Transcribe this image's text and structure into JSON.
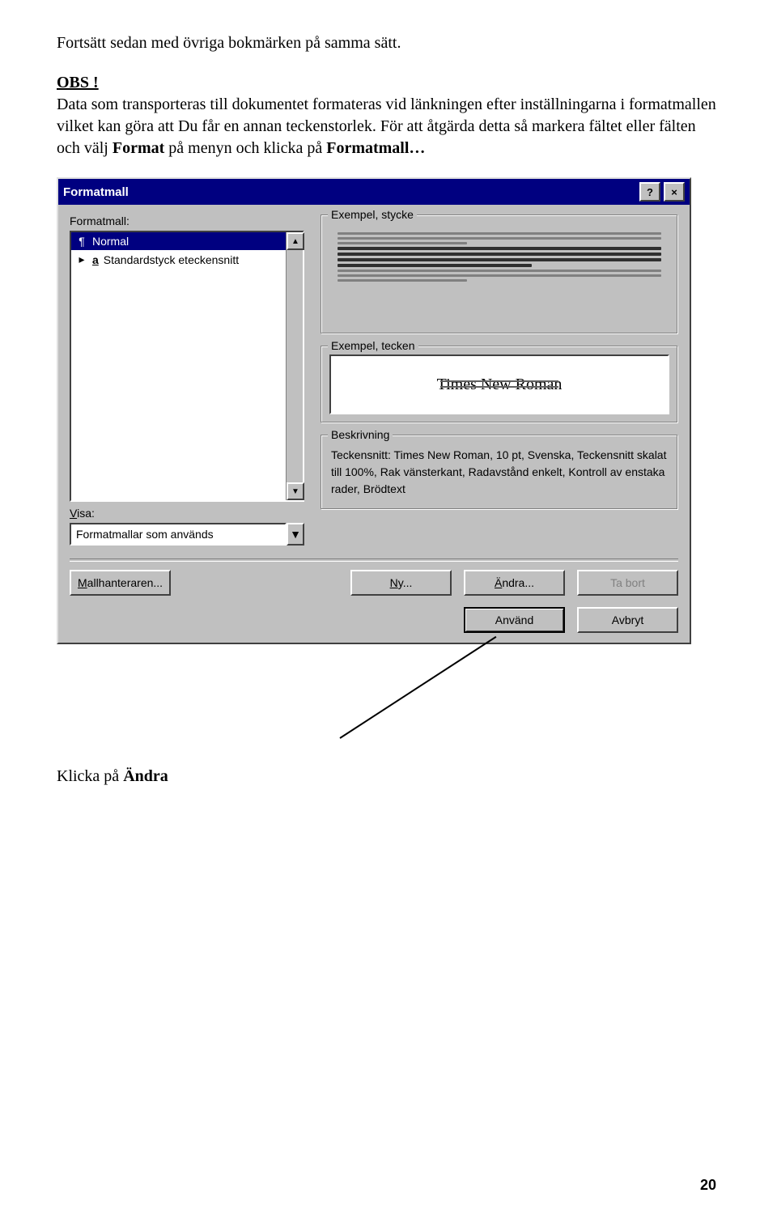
{
  "doc": {
    "p1": "Fortsätt sedan med övriga bokmärken på samma sätt.",
    "obs": "OBS !",
    "p2a": "Data som transporteras till dokumentet formateras vid länkningen efter inställningarna i formatmallen vilket kan göra att Du får en annan teckenstorlek. För att åtgärda detta så markera fältet eller fälten och välj ",
    "p2b": "Format",
    "p2c": " på menyn och klicka på ",
    "p2d": "Formatmall…",
    "after1": "Klicka på ",
    "after1b": "Ändra",
    "page": "20"
  },
  "dialog": {
    "title": "Formatmall",
    "lbl_formatmall": "Formatmall:",
    "list": {
      "item1": "Normal",
      "item2": "Standardstyck eteckensnitt"
    },
    "lbl_visa": "Visa:",
    "visa_value": "Formatmallar som används",
    "grp_stycke": "Exempel, stycke",
    "grp_tecken": "Exempel, tecken",
    "preview_font": "Times New Roman",
    "grp_desc": "Beskrivning",
    "desc_text": "Teckensnitt: Times New Roman, 10 pt, Svenska, Teckensnitt skalat till 100%, Rak vänsterkant, Radavstånd enkelt, Kontroll av enstaka rader, Brödtext",
    "btn_mall": "Mallhanteraren...",
    "btn_ny": "Ny...",
    "btn_andra": "Ändra...",
    "btn_tabort": "Ta bort",
    "btn_anvand": "Använd",
    "btn_avbryt": "Avbryt"
  }
}
